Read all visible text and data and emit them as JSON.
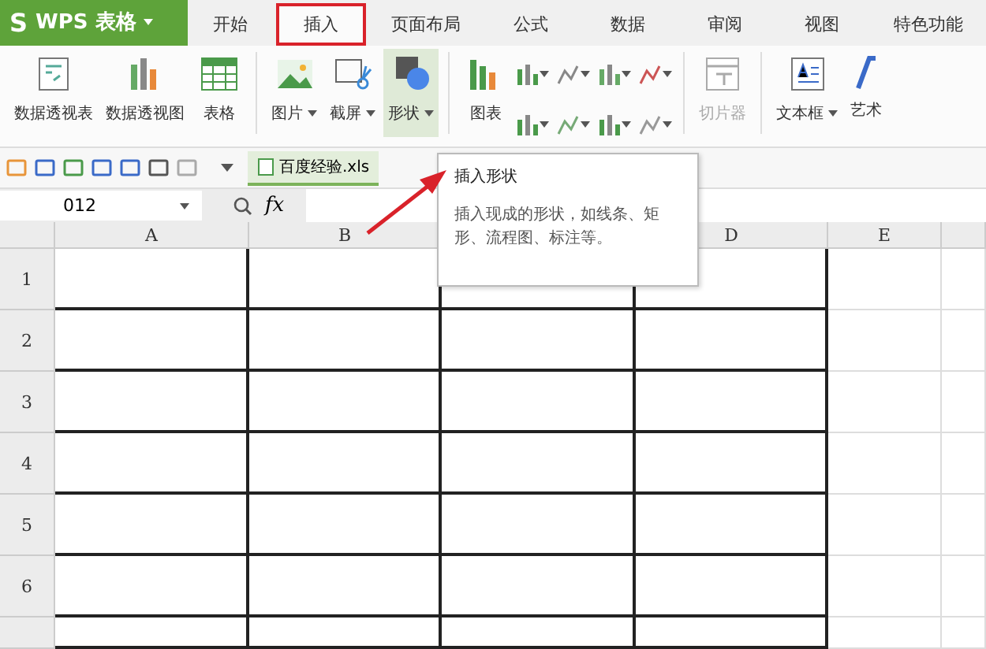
{
  "app_button": {
    "logo": "S",
    "label": "WPS 表格"
  },
  "tabs": [
    {
      "label": "开始",
      "selected": false
    },
    {
      "label": "插入",
      "selected": true
    },
    {
      "label": "页面布局",
      "selected": false
    },
    {
      "label": "公式",
      "selected": false
    },
    {
      "label": "数据",
      "selected": false
    },
    {
      "label": "审阅",
      "selected": false
    },
    {
      "label": "视图",
      "selected": false
    },
    {
      "label": "特色功能",
      "selected": false
    }
  ],
  "ribbon": [
    {
      "kind": "large",
      "label": "数据透视表",
      "dropdown": false,
      "hovered": false,
      "disabled": false
    },
    {
      "kind": "large",
      "label": "数据透视图",
      "dropdown": false,
      "hovered": false,
      "disabled": false
    },
    {
      "kind": "large",
      "label": "表格",
      "dropdown": false,
      "hovered": false,
      "disabled": false
    },
    {
      "kind": "separator"
    },
    {
      "kind": "large",
      "label": "图片",
      "dropdown": true,
      "hovered": false,
      "disabled": false
    },
    {
      "kind": "large",
      "label": "截屏",
      "dropdown": true,
      "hovered": false,
      "disabled": false
    },
    {
      "kind": "large",
      "label": "形状",
      "dropdown": true,
      "hovered": true,
      "disabled": false
    },
    {
      "kind": "separator"
    },
    {
      "kind": "large",
      "label": "图表",
      "dropdown": false,
      "hovered": false,
      "disabled": false
    },
    {
      "kind": "chart-grid"
    },
    {
      "kind": "separator"
    },
    {
      "kind": "large",
      "label": "切片器",
      "dropdown": false,
      "hovered": false,
      "disabled": true
    },
    {
      "kind": "separator"
    },
    {
      "kind": "large",
      "label": "文本框",
      "dropdown": true,
      "hovered": false,
      "disabled": false
    },
    {
      "kind": "large",
      "label": "艺术",
      "dropdown": false,
      "hovered": false,
      "disabled": false
    }
  ],
  "file_tab": {
    "label": "百度经验.xls"
  },
  "formula_bar": {
    "name_box": "012",
    "fx": "fx"
  },
  "tooltip": {
    "title": "插入形状",
    "body": "插入现成的形状，如线条、矩形、流程图、标注等。"
  },
  "columns": [
    "A",
    "B",
    "D",
    "E"
  ],
  "rows": [
    "1",
    "2",
    "3",
    "4",
    "5",
    "6"
  ]
}
